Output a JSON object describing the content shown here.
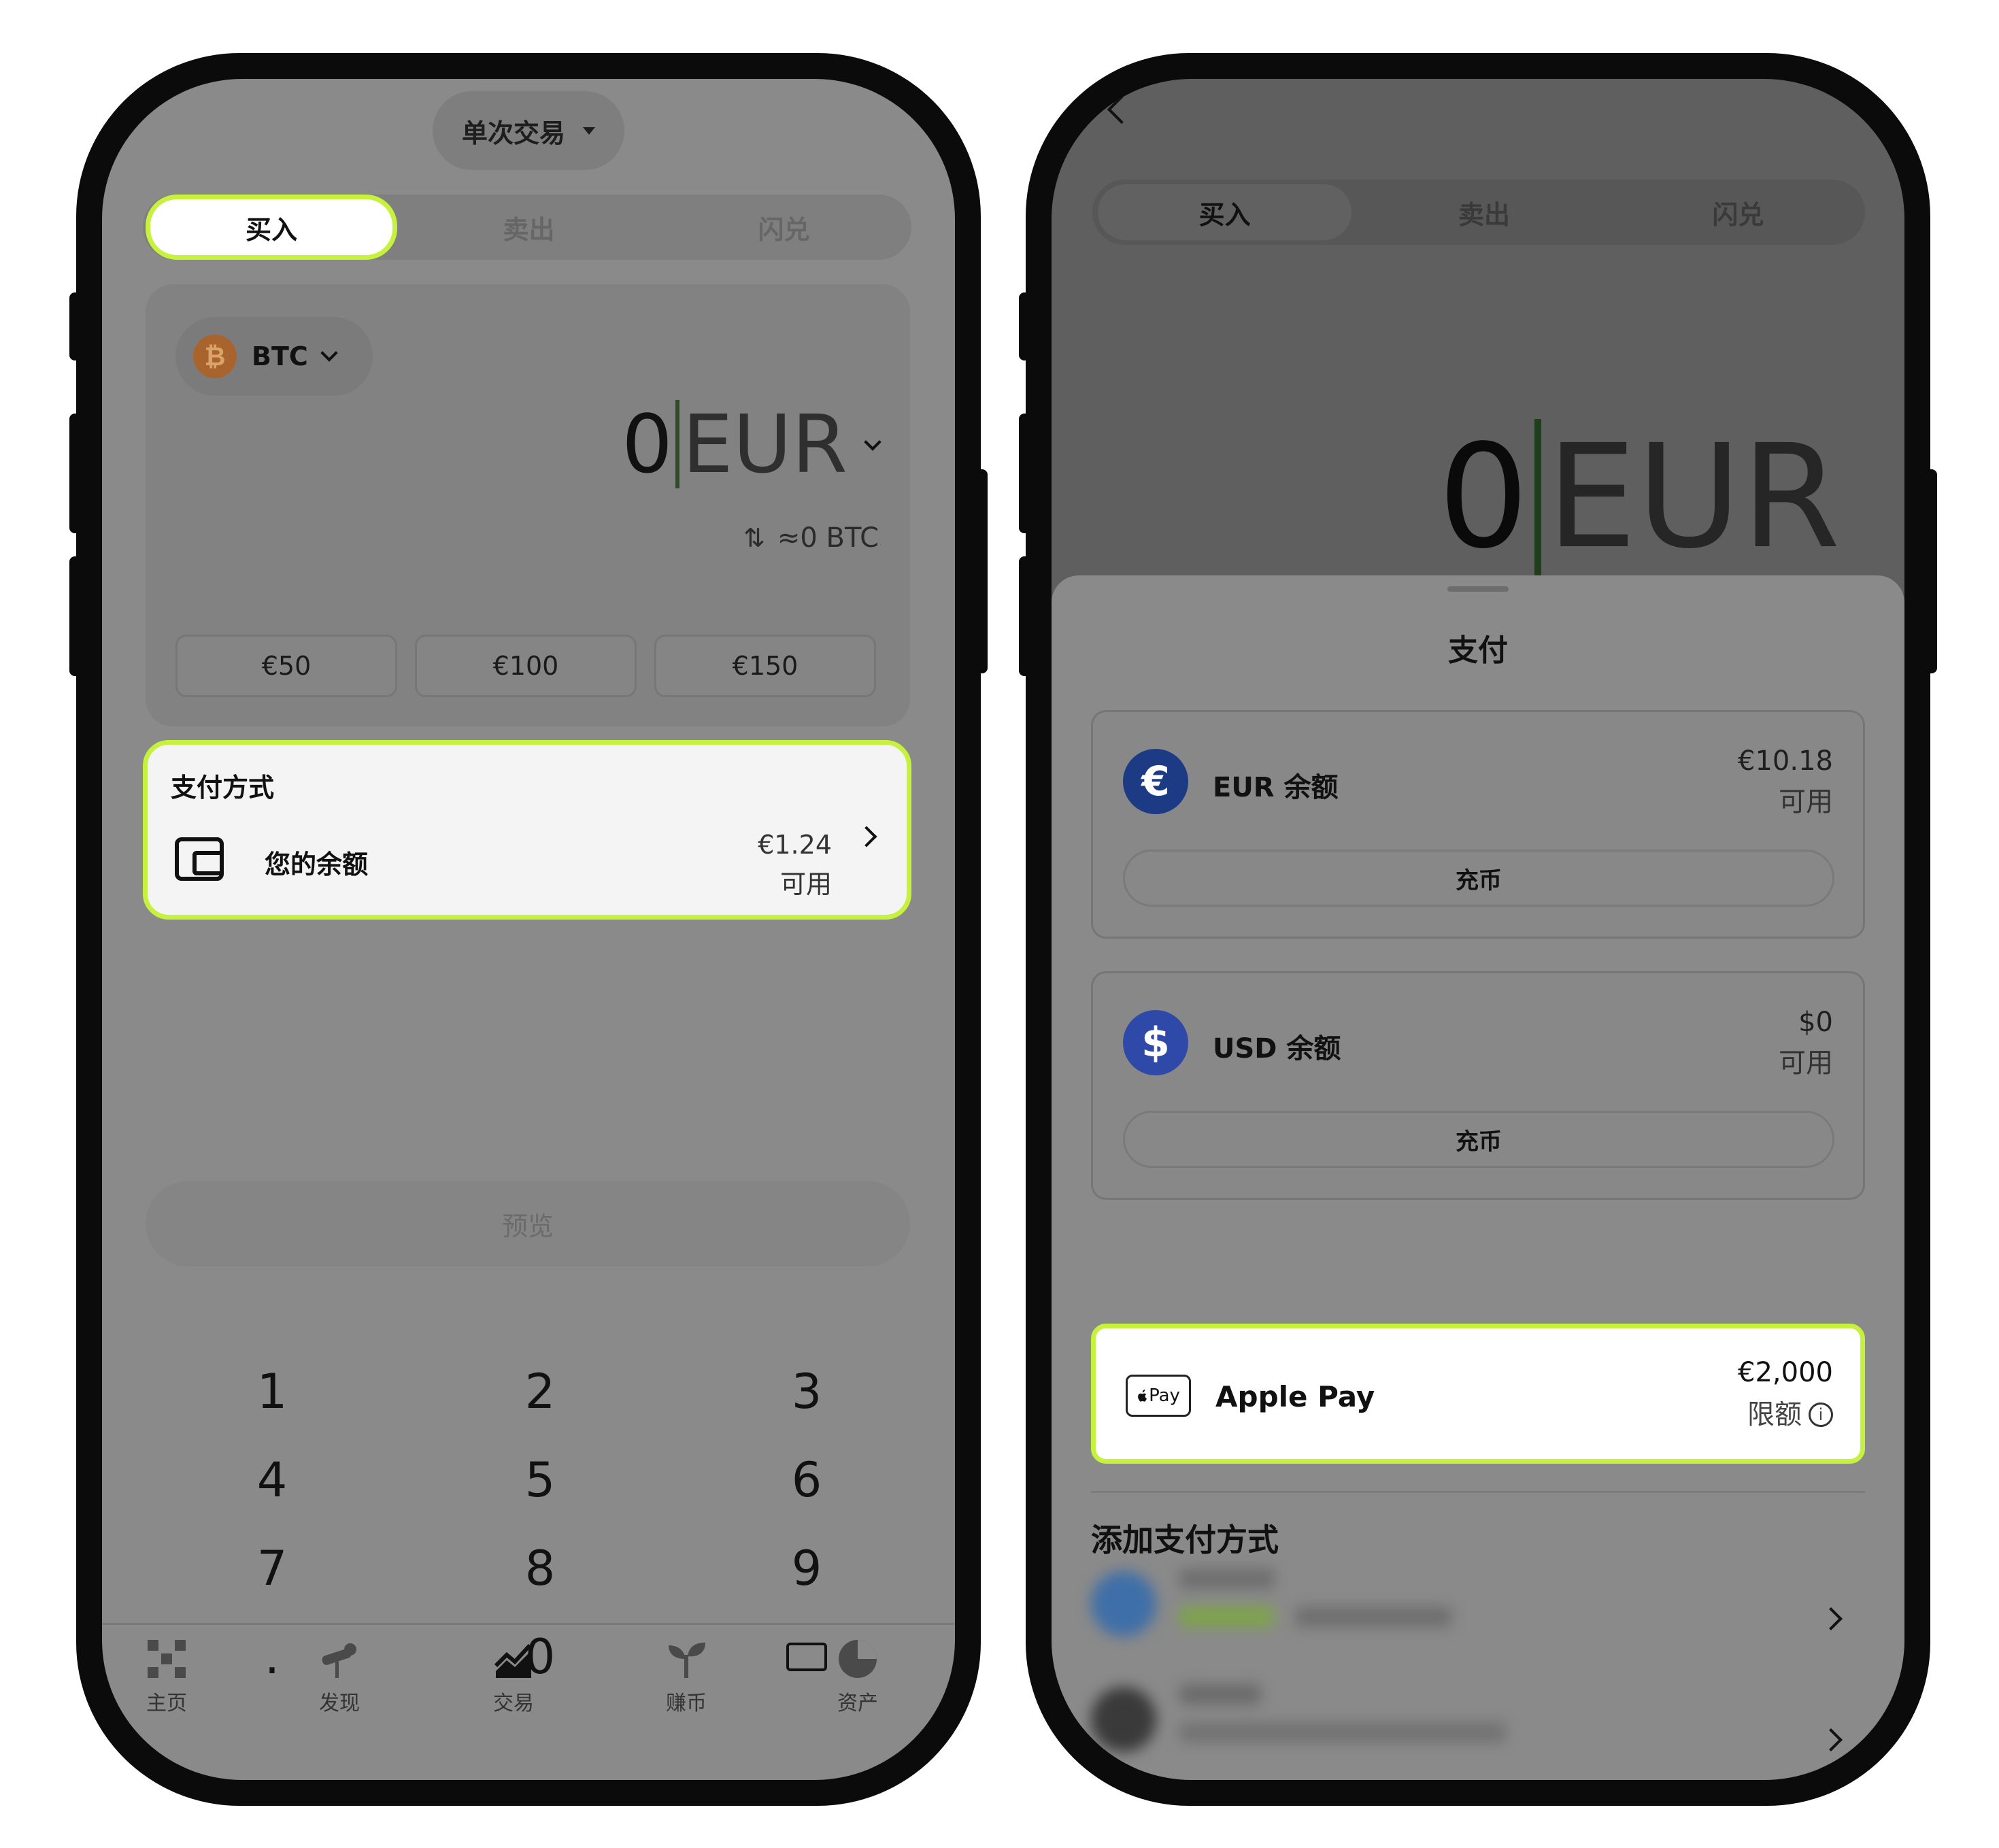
{
  "phoneA": {
    "mode_selector": "单次交易",
    "tabs": [
      "买入",
      "卖出",
      "闪兑"
    ],
    "asset": {
      "symbol": "BTC",
      "icon": "bitcoin-icon"
    },
    "amount": {
      "value": "0",
      "currency": "EUR"
    },
    "conversion": "≈0 BTC",
    "presets": [
      "€50",
      "€100",
      "€150"
    ],
    "payment_method": {
      "title": "支付方式",
      "label": "您的余额",
      "amount": "€1.24",
      "status": "可用"
    },
    "preview_button": "预览",
    "keypad": [
      "1",
      "2",
      "3",
      "4",
      "5",
      "6",
      "7",
      "8",
      "9",
      ".",
      "0"
    ],
    "bottom_nav": [
      {
        "label": "主页",
        "icon": "home-grid-icon"
      },
      {
        "label": "发现",
        "icon": "telescope-icon"
      },
      {
        "label": "交易",
        "icon": "trade-chart-icon"
      },
      {
        "label": "赚币",
        "icon": "sprout-icon"
      },
      {
        "label": "资产",
        "icon": "pie-chart-icon"
      }
    ]
  },
  "phoneB": {
    "tabs": [
      "买入",
      "卖出",
      "闪兑"
    ],
    "amount": {
      "value": "0",
      "currency": "EUR"
    },
    "sheet_title": "支付",
    "options": [
      {
        "name": "EUR 余额",
        "symbol": "€",
        "amount": "€10.18",
        "status": "可用",
        "button": "充币"
      },
      {
        "name": "USD 余额",
        "symbol": "$",
        "amount": "$0",
        "status": "可用",
        "button": "充币"
      }
    ],
    "apple_pay": {
      "badge": "Pay",
      "name": "Apple Pay",
      "amount": "€2,000",
      "limit_label": "限额"
    },
    "add_title": "添加支付方式"
  },
  "colors": {
    "highlight": "#c6f13c",
    "eur_icon": "#1d3b84",
    "usd_icon": "#2f49a8",
    "btc_icon": "#a8642c"
  }
}
